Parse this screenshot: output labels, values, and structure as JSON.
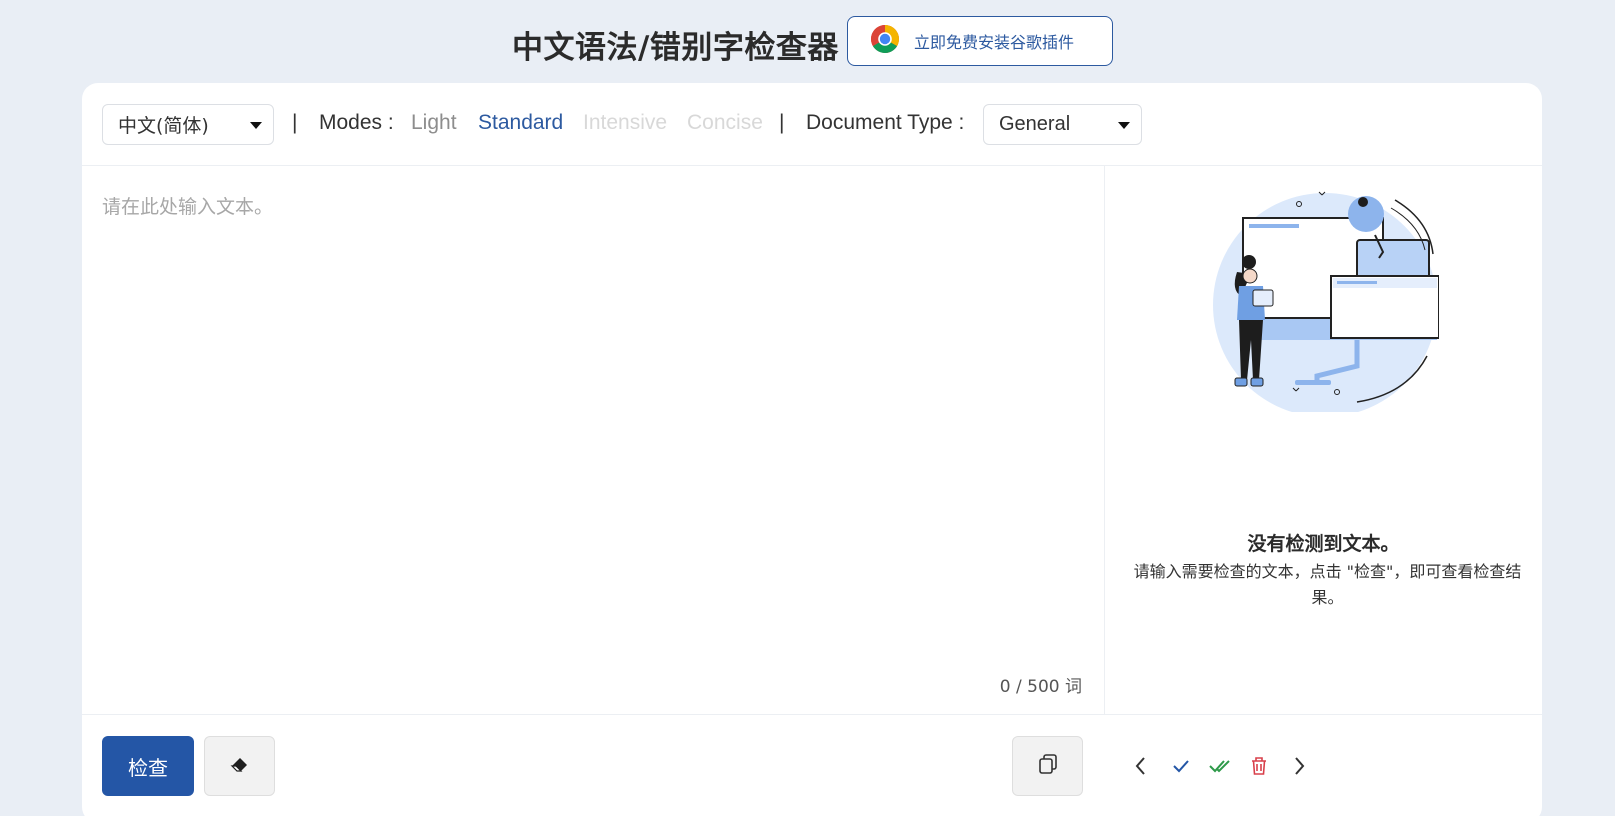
{
  "header": {
    "title": "中文语法/错别字检查器",
    "install_button": "立即免费安装谷歌插件",
    "chrome_icon": "chrome-icon"
  },
  "toolbar": {
    "language_select": "中文(简体)",
    "divider": "|",
    "modes_label": "Modes :",
    "modes": [
      "Light",
      "Standard",
      "Intensive",
      "Concise"
    ],
    "active_mode": "Standard",
    "document_type_label": "Document Type :",
    "document_type_select": "General"
  },
  "editor": {
    "placeholder": "请在此处输入文本。",
    "value": "",
    "word_count": "0 / 500 词"
  },
  "results": {
    "illustration": "person-with-screens-illustration",
    "empty_title": "没有检测到文本。",
    "empty_description": "请输入需要检查的文本，点击 \"检查\"，即可查看检查结果。"
  },
  "bottom": {
    "check_button": "检查",
    "eraser_icon": "eraser-icon",
    "copy_icon": "copy-icon",
    "nav_icons": [
      "chevron-left-icon",
      "check-icon",
      "double-check-icon",
      "trash-icon",
      "chevron-right-icon"
    ]
  },
  "colors": {
    "background": "#e9eef5",
    "accent": "#2456a6",
    "accept_all": "#2e9a4a",
    "delete": "#d9404b"
  }
}
